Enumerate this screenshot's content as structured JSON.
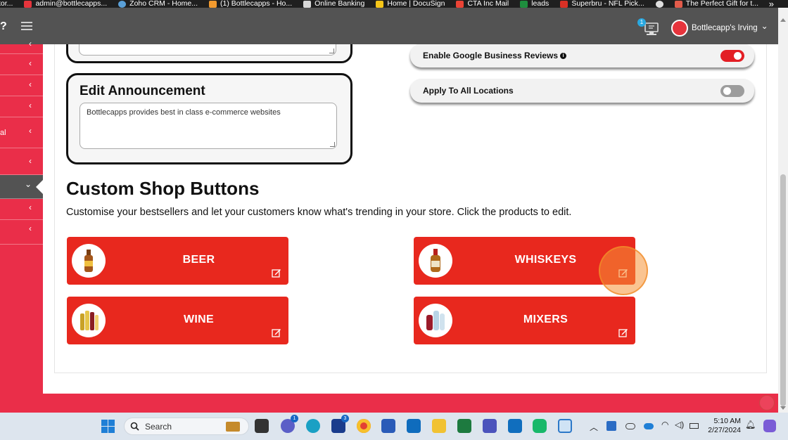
{
  "bookmarks": [
    {
      "label": "tor...",
      "color": "#1f1f1f"
    },
    {
      "label": "admin@bottlecapps...",
      "color": "#e6343c"
    },
    {
      "label": "Zoho CRM - Home...",
      "color": "#5aa0d8"
    },
    {
      "label": "(1) Bottlecapps - Ho...",
      "color": "#f29a2e"
    },
    {
      "label": "Online Banking",
      "color": "#d8d8d8"
    },
    {
      "label": "Home | DocuSign",
      "color": "#f5c518"
    },
    {
      "label": "CTA Inc Mail",
      "color": "#ea4335"
    },
    {
      "label": "leads",
      "color": "#1e8e3e"
    },
    {
      "label": "Superbru - NFL Pick...",
      "color": "#d93025"
    },
    {
      "label": "",
      "color": "#dddddd"
    },
    {
      "label": "The Perfect Gift for t...",
      "color": "#e25b4a"
    }
  ],
  "bookmarks_more": "»",
  "header": {
    "logo_stub": "?",
    "notification_count": "1",
    "user_name": "Bottlecapp's Irving",
    "user_chevron": "⌄"
  },
  "sidebar": {
    "items": [
      {
        "chev": "‹",
        "stub": ""
      },
      {
        "chev": "‹",
        "stub": ""
      },
      {
        "chev": "‹",
        "stub": ""
      },
      {
        "chev": "‹",
        "stub": ""
      },
      {
        "chev": "‹",
        "stub": "al"
      },
      {
        "chev": "‹",
        "stub": ""
      },
      {
        "chev": "⌄",
        "stub": ""
      },
      {
        "chev": "‹",
        "stub": ""
      },
      {
        "chev": "‹",
        "stub": ""
      }
    ]
  },
  "announcement": {
    "title": "Edit Announcement",
    "text": "Bottlecapps provides best in class e-commerce websites"
  },
  "toggles": [
    {
      "label": "Enable Google Business Reviews",
      "info_icon": "i",
      "state": "on"
    },
    {
      "label": "Apply To All Locations",
      "state": "off"
    }
  ],
  "custom_shop": {
    "title": "Custom Shop Buttons",
    "description": "Customise your bestsellers and let your customers know what's trending in your store. Click the products to edit.",
    "buttons": [
      {
        "label": "BEER",
        "icon": "beer-bottle-icon"
      },
      {
        "label": "WHISKEYS",
        "icon": "whiskey-bottle-icon"
      },
      {
        "label": "WINE",
        "icon": "wine-bottles-icon"
      },
      {
        "label": "MIXERS",
        "icon": "mixer-bottles-icon"
      }
    ]
  },
  "taskbar": {
    "search_placeholder": "Search",
    "chat_badge": "1",
    "l_badge": "3",
    "time": "5:10 AM",
    "date": "2/27/2024"
  },
  "colors": {
    "brand_red": "#ea2e49",
    "button_red": "#e8281e",
    "header_gray": "#535353"
  }
}
